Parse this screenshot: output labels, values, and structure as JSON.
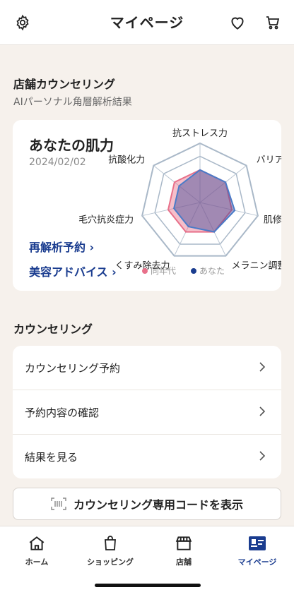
{
  "header": {
    "title": "マイページ"
  },
  "counseling_result": {
    "section_title": "店舗カウンセリング",
    "section_sub": "AIパーソナル角層解析結果",
    "card_title": "あなたの肌力",
    "date": "2024/02/02",
    "link_reanalysis": "再解析予約 ›",
    "link_advice": "美容アドバイス ›",
    "radar_axes": [
      "抗ストレス力",
      "バリア力",
      "肌修復力",
      "メラニン調整力",
      "くすみ除去力",
      "毛穴抗炎症力",
      "抗酸化力"
    ],
    "radar_series": [
      {
        "name": "同年代",
        "color": "#e8708a",
        "values": [
          0.55,
          0.55,
          0.55,
          0.55,
          0.55,
          0.55,
          0.55
        ]
      },
      {
        "name": "あなた",
        "color": "#2f4f9f",
        "values": [
          0.55,
          0.55,
          0.6,
          0.55,
          0.45,
          0.45,
          0.45
        ]
      }
    ],
    "legend": {
      "peer": "同年代",
      "you": "あなた"
    }
  },
  "counseling": {
    "section_title": "カウンセリング",
    "items": [
      {
        "label": "カウンセリング予約"
      },
      {
        "label": "予約内容の確認"
      },
      {
        "label": "結果を見る"
      }
    ],
    "code_button": "カウンセリング専用コードを表示"
  },
  "tabbar": {
    "tabs": [
      {
        "label": "ホーム",
        "icon": "home-icon"
      },
      {
        "label": "ショッピング",
        "icon": "shopping-bag-icon"
      },
      {
        "label": "店舗",
        "icon": "store-icon"
      },
      {
        "label": "マイページ",
        "icon": "member-card-icon"
      }
    ],
    "active_color": "#1a3c8f"
  }
}
